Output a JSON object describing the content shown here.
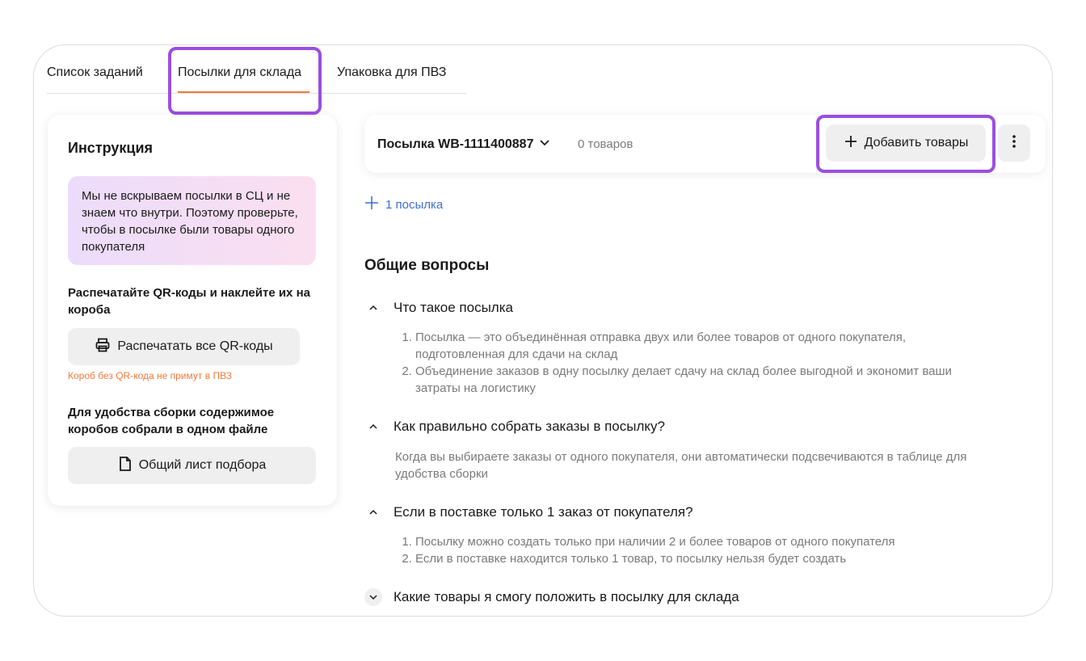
{
  "tabs": [
    {
      "label": "Список заданий"
    },
    {
      "label": "Посылки для склада"
    },
    {
      "label": "Упаковка для ПВЗ"
    }
  ],
  "instruction": {
    "title": "Инструкция",
    "notice": "Мы не вскрываем посылки в СЦ и не знаем что внутри. Поэтому проверьте, чтобы в посылке были товары одного покупателя",
    "step1_heading": "Распечатайте QR-коды и наклейте их на короба",
    "print_button": "Распечатать все QR-коды",
    "warning": "Короб без QR-кода не примут в ПВЗ",
    "step2_heading": "Для удобства сборки содержимое коробов собрали в одном файле",
    "picklist_button": "Общий лист подбора"
  },
  "parcel": {
    "name": "Посылка WB-1111400887",
    "count": "0 товаров",
    "add_button": "Добавить товары"
  },
  "add_parcel": "1 посылка",
  "faq": {
    "title": "Общие вопросы",
    "items": [
      {
        "question": "Что такое посылка",
        "answer": [
          "Посылка — это объединённая отправка двух или более товаров от одного покупателя, подготовленная для сдачи на склад",
          "Объединение заказов в одну посылку делает сдачу на склад более выгодной и экономит ваши затраты на логистику"
        ]
      },
      {
        "question": "Как правильно собрать заказы в посылку?",
        "answer_text": "Когда вы выбираете заказы от одного покупателя, они автоматически подсвечиваются в таблице для удобства сборки"
      },
      {
        "question": "Если в поставке только 1 заказ от покупателя?",
        "answer": [
          "Посылку можно создать только при наличии 2 и более товаров от одного покупателя",
          "Если в поставке находится только 1 товар, то посылку нельзя будет создать"
        ]
      },
      {
        "question": "Какие товары я смогу положить в посылку для склада"
      }
    ]
  },
  "colors": {
    "accent_orange": "#f07a3a",
    "highlight_purple": "#9b4ee0",
    "link_blue": "#3f6fd8"
  }
}
